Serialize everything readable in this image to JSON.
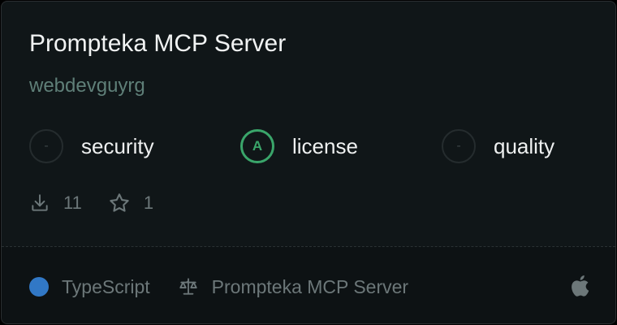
{
  "card": {
    "title": "Prompteka MCP Server",
    "author": "webdevguyrg"
  },
  "scores": [
    {
      "grade": "-",
      "label": "security",
      "graded": false
    },
    {
      "grade": "A",
      "label": "license",
      "graded": true
    },
    {
      "grade": "-",
      "label": "quality",
      "graded": false
    }
  ],
  "stats": {
    "downloads": "11",
    "stars": "1",
    "download_icon": "download-icon",
    "star_icon": "star-icon"
  },
  "footer": {
    "language": "TypeScript",
    "language_color": "#3178c6",
    "license_icon": "scale-icon",
    "license_name": "Prompteka MCP Server",
    "platform_icon": "apple-icon"
  },
  "colors": {
    "graded_green": "#3aa56a",
    "card_background": "#101618"
  }
}
